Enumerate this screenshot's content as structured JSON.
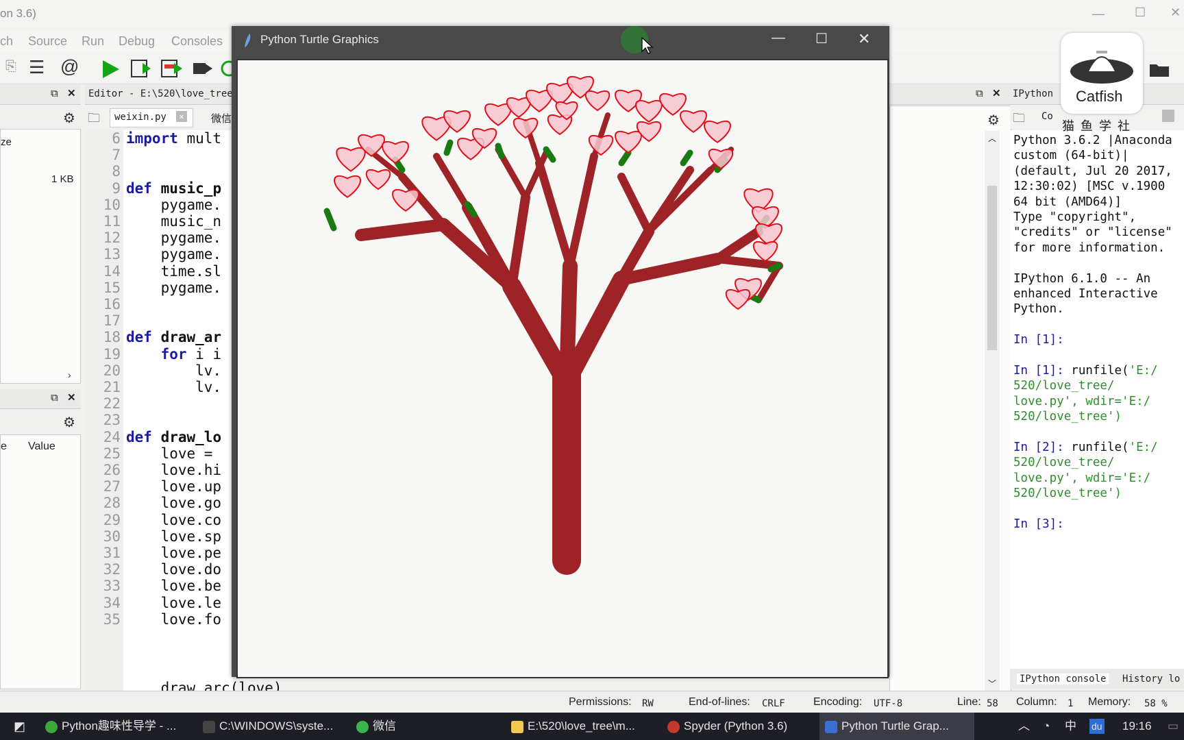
{
  "spyder": {
    "title_fragment": "on 3.6)",
    "menu": [
      "ch",
      "Source",
      "Run",
      "Debug",
      "Consoles"
    ],
    "file_size": "1 KB",
    "size_header": "ze",
    "var_header_value": "Value",
    "var_header_e": "e",
    "editor_title": "Editor - E:\\520\\love_tree",
    "editor_tabs": [
      "weixin.py",
      "微信"
    ],
    "ipython_title": "IPython",
    "ipython_tab": "Co",
    "code_lines": [
      {
        "n": "6",
        "t": "import mult"
      },
      {
        "n": "7",
        "t": ""
      },
      {
        "n": "8",
        "t": ""
      },
      {
        "n": "9",
        "t": "def music_p"
      },
      {
        "n": "10",
        "t": "    pygame."
      },
      {
        "n": "11",
        "t": "    music_n"
      },
      {
        "n": "12",
        "t": "    pygame."
      },
      {
        "n": "13",
        "t": "    pygame."
      },
      {
        "n": "14",
        "t": "    time.sl"
      },
      {
        "n": "15",
        "t": "    pygame."
      },
      {
        "n": "16",
        "t": ""
      },
      {
        "n": "17",
        "t": ""
      },
      {
        "n": "18",
        "t": "def draw_ar"
      },
      {
        "n": "19",
        "t": "    for i i"
      },
      {
        "n": "20",
        "t": "        lv."
      },
      {
        "n": "21",
        "t": "        lv."
      },
      {
        "n": "22",
        "t": ""
      },
      {
        "n": "23",
        "t": ""
      },
      {
        "n": "24",
        "t": "def draw_lo"
      },
      {
        "n": "25",
        "t": "    love ="
      },
      {
        "n": "26",
        "t": "    love.hi"
      },
      {
        "n": "27",
        "t": "    love.up"
      },
      {
        "n": "28",
        "t": "    love.go"
      },
      {
        "n": "29",
        "t": "    love.co"
      },
      {
        "n": "30",
        "t": "    love.sp"
      },
      {
        "n": "31",
        "t": "    love.pe"
      },
      {
        "n": "32",
        "t": "    love.do"
      },
      {
        "n": "33",
        "t": "    love.be"
      },
      {
        "n": "34",
        "t": "    love.le"
      },
      {
        "n": "35",
        "t": "    love.fo"
      }
    ],
    "code_partial_last": "    draw_arc(love)",
    "ipython_lines": [
      {
        "t": "Python 3.6.2 |Anaconda",
        "c": ""
      },
      {
        "t": "custom (64-bit)|",
        "c": ""
      },
      {
        "t": "(default, Jul 20 2017,",
        "c": ""
      },
      {
        "t": "12:30:02) [MSC v.1900",
        "c": ""
      },
      {
        "t": "64 bit (AMD64)]",
        "c": ""
      },
      {
        "t": "Type \"copyright\",",
        "c": ""
      },
      {
        "t": "\"credits\" or \"license\"",
        "c": ""
      },
      {
        "t": "for more information.",
        "c": ""
      },
      {
        "t": "",
        "c": ""
      },
      {
        "t": "IPython 6.1.0 -- An",
        "c": ""
      },
      {
        "t": "enhanced Interactive",
        "c": ""
      },
      {
        "t": "Python.",
        "c": ""
      },
      {
        "t": "",
        "c": ""
      },
      {
        "t": "In [1]:",
        "c": "prompt"
      },
      {
        "t": "",
        "c": ""
      },
      {
        "t": "In [1]: runfile('E:/",
        "c": "mix"
      },
      {
        "t": "520/love_tree/",
        "c": "green"
      },
      {
        "t": "love.py', wdir='E:/",
        "c": "green"
      },
      {
        "t": "520/love_tree')",
        "c": "green"
      },
      {
        "t": "",
        "c": ""
      },
      {
        "t": "In [2]: runfile('E:/",
        "c": "mix"
      },
      {
        "t": "520/love_tree/",
        "c": "green"
      },
      {
        "t": "love.py', wdir='E:/",
        "c": "green"
      },
      {
        "t": "520/love_tree')",
        "c": "green"
      },
      {
        "t": "",
        "c": ""
      },
      {
        "t": "In [3]:",
        "c": "prompt"
      }
    ],
    "console_tabs": [
      "IPython console",
      "History lo"
    ],
    "status": {
      "permissions_label": "Permissions:",
      "permissions": "RW",
      "eol_label": "End-of-lines:",
      "eol": "CRLF",
      "encoding_label": "Encoding:",
      "encoding": "UTF-8",
      "line_label": "Line:",
      "line": "58",
      "column_label": "Column:",
      "column": "1",
      "memory_label": "Memory:",
      "memory": "58 %"
    }
  },
  "turtle": {
    "title": "Python Turtle Graphics",
    "trunk_color": "#9e2327",
    "heart_fill": "#f7c4cf",
    "heart_stroke": "#e0101a",
    "leaf_color": "#1a7a12"
  },
  "catfish": {
    "name": "Catfish",
    "subtitle": "猫 鱼 学 社"
  },
  "taskbar": {
    "items": [
      {
        "label": "Python趣味性导学 - ...",
        "color": "#3aa83a"
      },
      {
        "label": "C:\\WINDOWS\\syste...",
        "color": "#444"
      },
      {
        "label": "微信",
        "color": "#3ab54a"
      },
      {
        "label": "E:\\520\\love_tree\\m...",
        "color": "#f2c94c"
      },
      {
        "label": "Spyder (Python 3.6)",
        "color": "#c0392b"
      },
      {
        "label": "Python Turtle Grap...",
        "color": "#3b6fd4"
      }
    ],
    "time": "19:16",
    "ime": "中",
    "du": "du"
  }
}
